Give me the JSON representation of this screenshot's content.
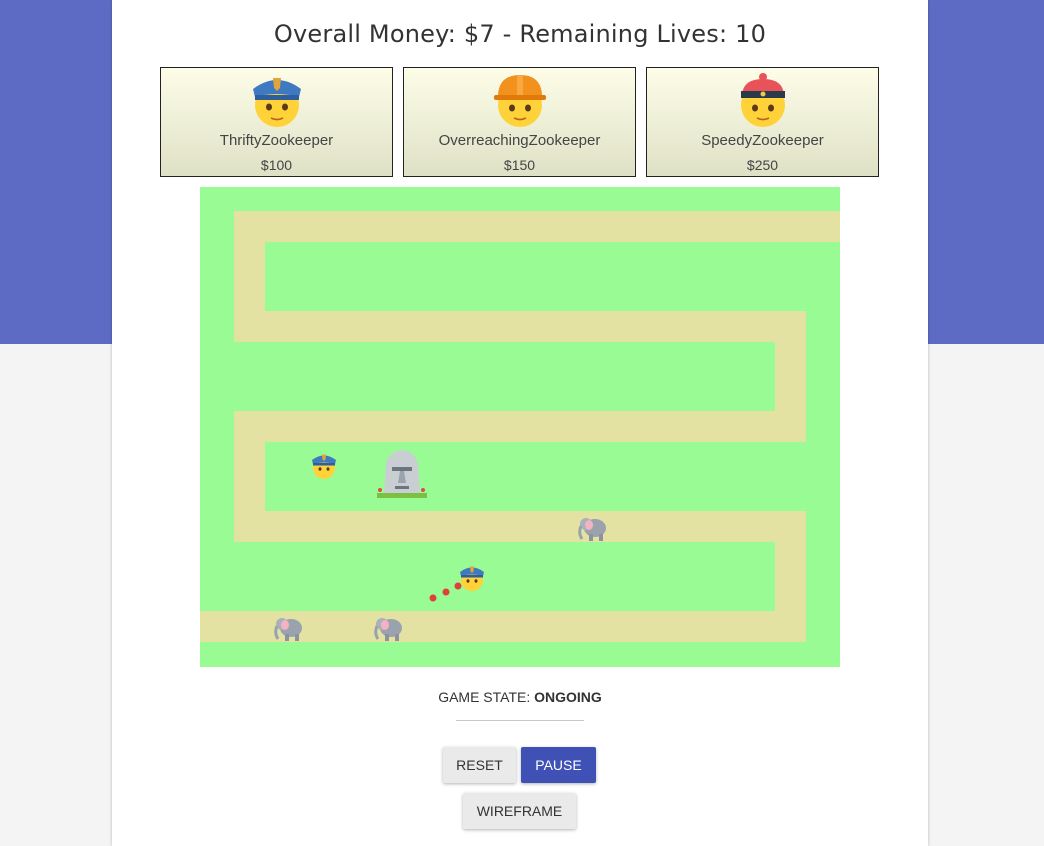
{
  "header": {
    "money_label": "Overall Money:",
    "money": "$7",
    "separator": "-",
    "lives_label": "Remaining Lives:",
    "lives": "10"
  },
  "shop": [
    {
      "name": "ThriftyZookeeper",
      "price": "$100",
      "hat": "police-cap",
      "hat_color": "#3e79c1"
    },
    {
      "name": "OverreachingZookeeper",
      "price": "$150",
      "hat": "hard-hat",
      "hat_color": "#f2911b"
    },
    {
      "name": "SpeedyZookeeper",
      "price": "$250",
      "hat": "skullcap",
      "hat_color": "#e8535a"
    }
  ],
  "board": {
    "grass_color": "#99fb93",
    "path_color": "#e3e2a2",
    "zookeepers": [
      {
        "type": "ThriftyZookeeper"
      },
      {
        "type": "ThriftyZookeeper",
        "projectiles": 3
      }
    ],
    "statues": [
      {
        "name": "moai-statue"
      }
    ],
    "elephants": 3
  },
  "status": {
    "label": "GAME STATE:",
    "value": "ONGOING"
  },
  "buttons": {
    "reset": "RESET",
    "pause": "PAUSE",
    "wireframe": "WIREFRAME"
  },
  "colors": {
    "band": "#5e6bc4",
    "primary": "#3f51b5"
  }
}
